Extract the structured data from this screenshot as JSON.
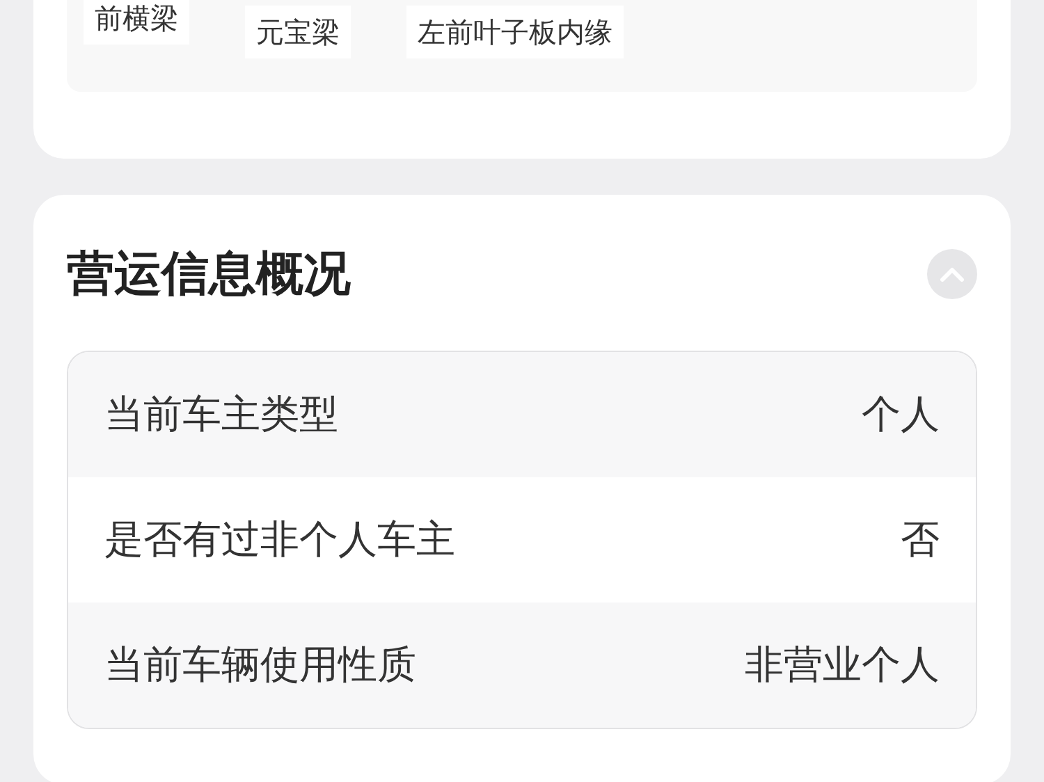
{
  "damage_tags": [
    "前横梁",
    "元宝梁",
    "左前叶子板内缘"
  ],
  "operation_card": {
    "title": "营运信息概况",
    "expanded": true,
    "rows": [
      {
        "label": "当前车主类型",
        "value": "个人"
      },
      {
        "label": "是否有过非个人车主",
        "value": "否"
      },
      {
        "label": "当前车辆使用性质",
        "value": "非营业个人"
      }
    ]
  }
}
